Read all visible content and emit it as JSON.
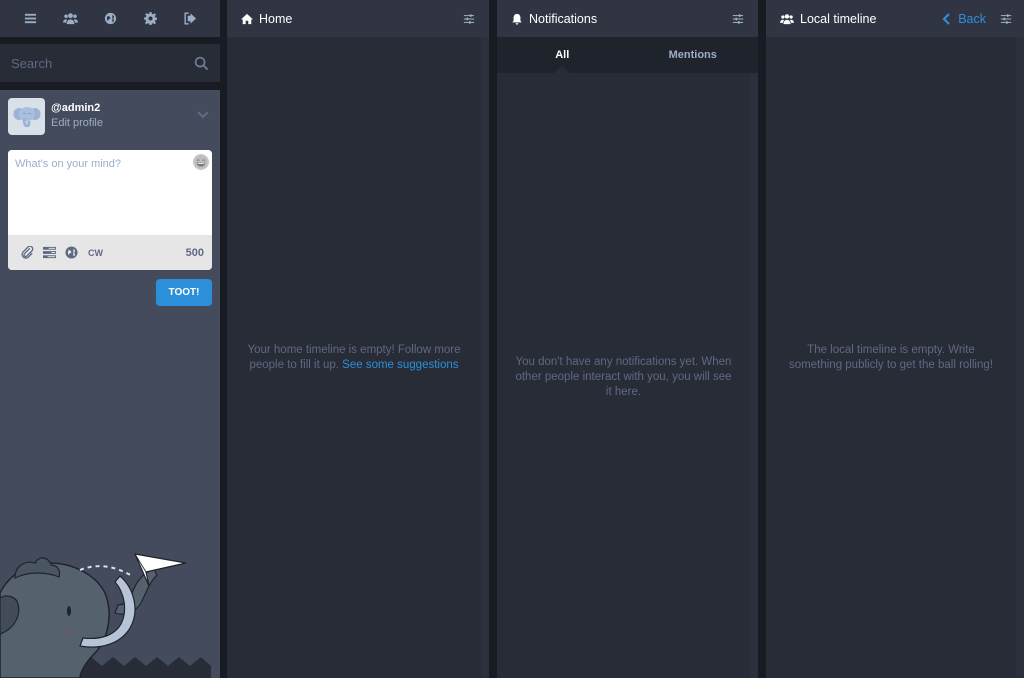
{
  "drawer": {
    "nav": [
      {
        "icon": "bars-icon",
        "label": "Getting started"
      },
      {
        "icon": "users-icon",
        "label": "Local timeline"
      },
      {
        "icon": "globe-icon",
        "label": "Federated timeline"
      },
      {
        "icon": "gear-icon",
        "label": "Preferences"
      },
      {
        "icon": "sign-out-icon",
        "label": "Logout"
      }
    ],
    "search": {
      "placeholder": "Search",
      "value": ""
    },
    "account": {
      "handle": "@admin2",
      "edit_label": "Edit profile"
    },
    "compose": {
      "placeholder": "What's on your mind?",
      "value": "",
      "cw_label": "CW",
      "char_count": "500",
      "toot_label": "TOOT!"
    }
  },
  "columns": {
    "home": {
      "title": "Home",
      "empty_text": "Your home timeline is empty! Follow more people to fill it up. ",
      "empty_link": "See some suggestions"
    },
    "notifications": {
      "title": "Notifications",
      "tabs": [
        {
          "label": "All",
          "active": true
        },
        {
          "label": "Mentions",
          "active": false
        }
      ],
      "empty_text": "You don't have any notifications yet. When other people interact with you, you will see it here."
    },
    "local": {
      "title": "Local timeline",
      "back_label": "Back",
      "empty_text": "The local timeline is empty. Write something publicly to get the ball rolling!"
    }
  },
  "colors": {
    "accent": "#2b90d9",
    "header_bg": "#313543",
    "column_bg": "#282c37",
    "drawer_bg": "#444b5d",
    "muted_text": "#606984",
    "secondary_text": "#9baec8"
  }
}
